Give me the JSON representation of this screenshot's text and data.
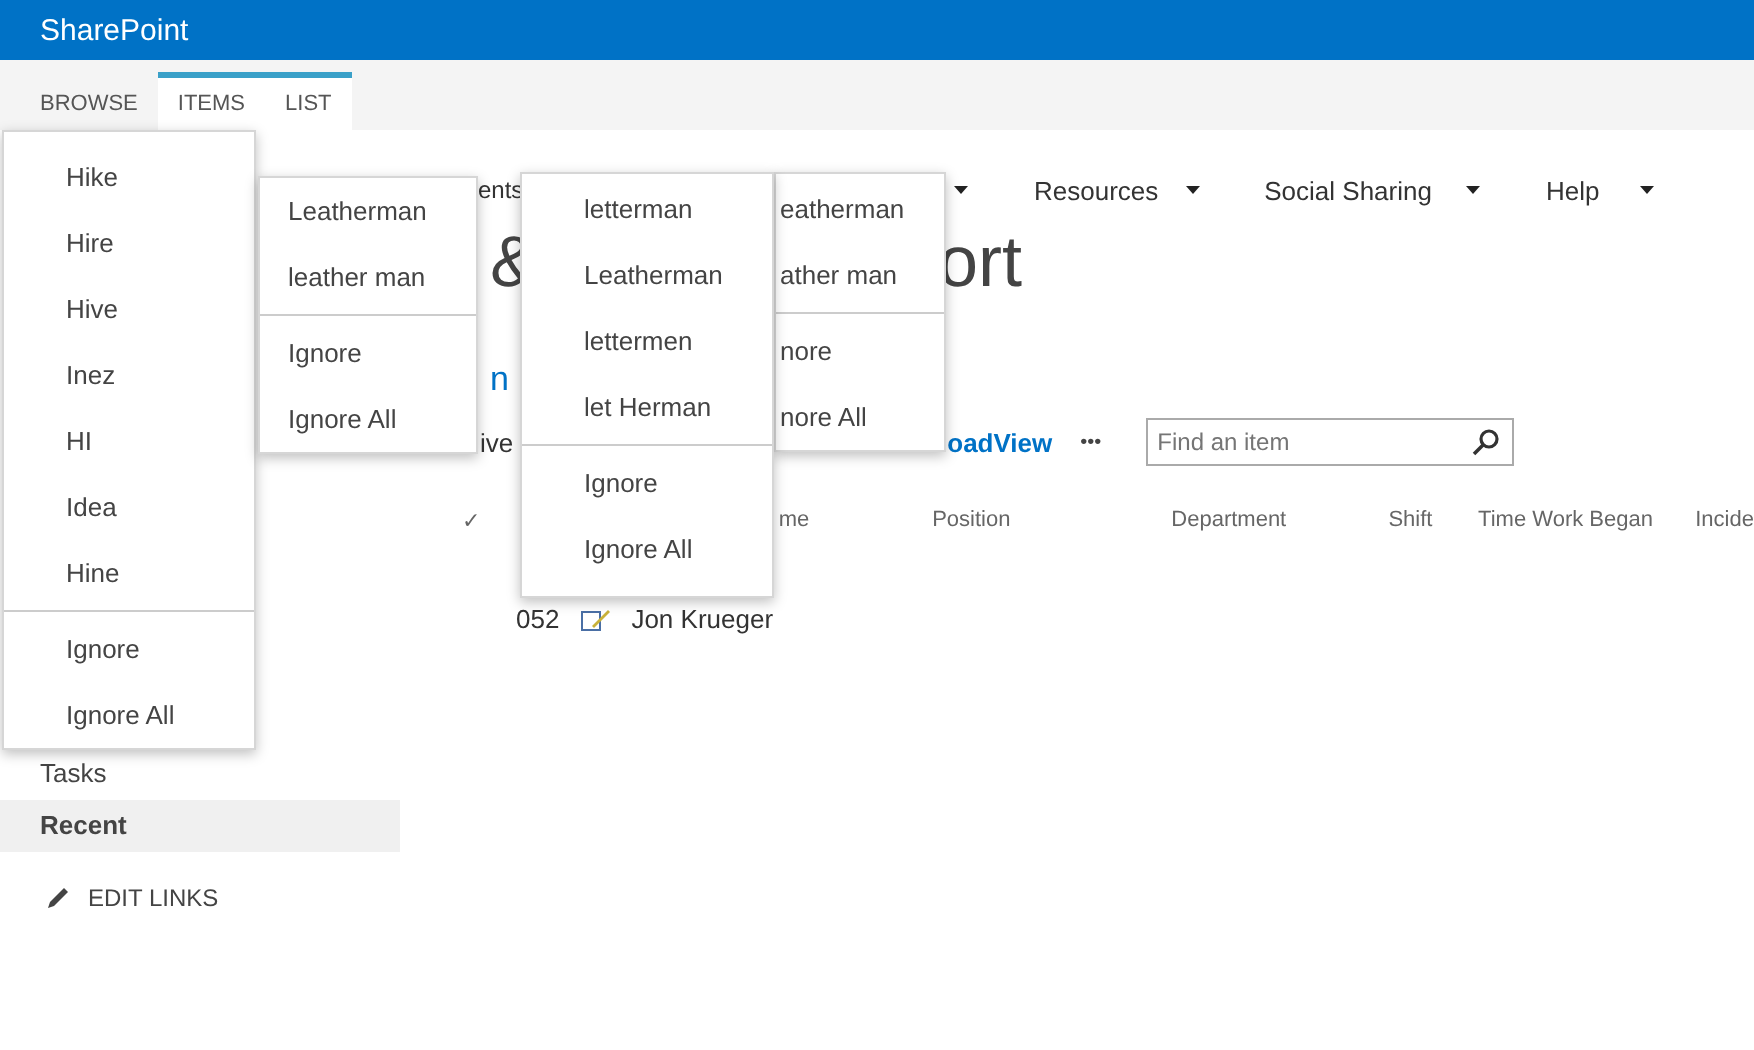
{
  "header": {
    "title": "SharePoint"
  },
  "ribbon_tabs": [
    {
      "label": "BROWSE",
      "contextual": false
    },
    {
      "label": "ITEMS",
      "contextual": true
    },
    {
      "label": "LIST",
      "contextual": true
    }
  ],
  "sidebar": {
    "items": [
      {
        "label": "Tasks",
        "selected": false
      },
      {
        "label": "Recent",
        "selected": true
      }
    ],
    "edit_links": "EDIT LINKS"
  },
  "top_nav": [
    {
      "label": "ents"
    },
    {
      "label": "Resources"
    },
    {
      "label": "Social Sharing"
    },
    {
      "label": "Help"
    }
  ],
  "title_fragments": [
    "&",
    "ort"
  ],
  "link_fragment": "n",
  "toolbar": {
    "view_fragment": "ive",
    "link": "oadView",
    "more": "•••",
    "search": {
      "placeholder": "Find an item"
    }
  },
  "list": {
    "check": "✓",
    "columns": [
      "me",
      "Position",
      "Department",
      "Shift",
      "Time Work Began",
      "Incide"
    ],
    "rows": [
      {
        "id": "052",
        "name": "Jon Krueger"
      }
    ]
  },
  "spelling_menus": [
    {
      "suggestions": [
        "Hike",
        "Hire",
        "Hive",
        "Inez",
        "HI",
        "Idea",
        "Hine"
      ],
      "actions": [
        "Ignore",
        "Ignore All"
      ]
    },
    {
      "suggestions": [
        "Leatherman",
        "leather man"
      ],
      "actions": [
        "Ignore",
        "Ignore All"
      ]
    },
    {
      "suggestions": [
        "letterman",
        "Leatherman",
        "lettermen",
        "let Herman"
      ],
      "actions": [
        "Ignore",
        "Ignore All"
      ]
    },
    {
      "suggestions": [
        "eatherman",
        "ather man"
      ],
      "actions": [
        "nore",
        "nore All"
      ]
    }
  ]
}
